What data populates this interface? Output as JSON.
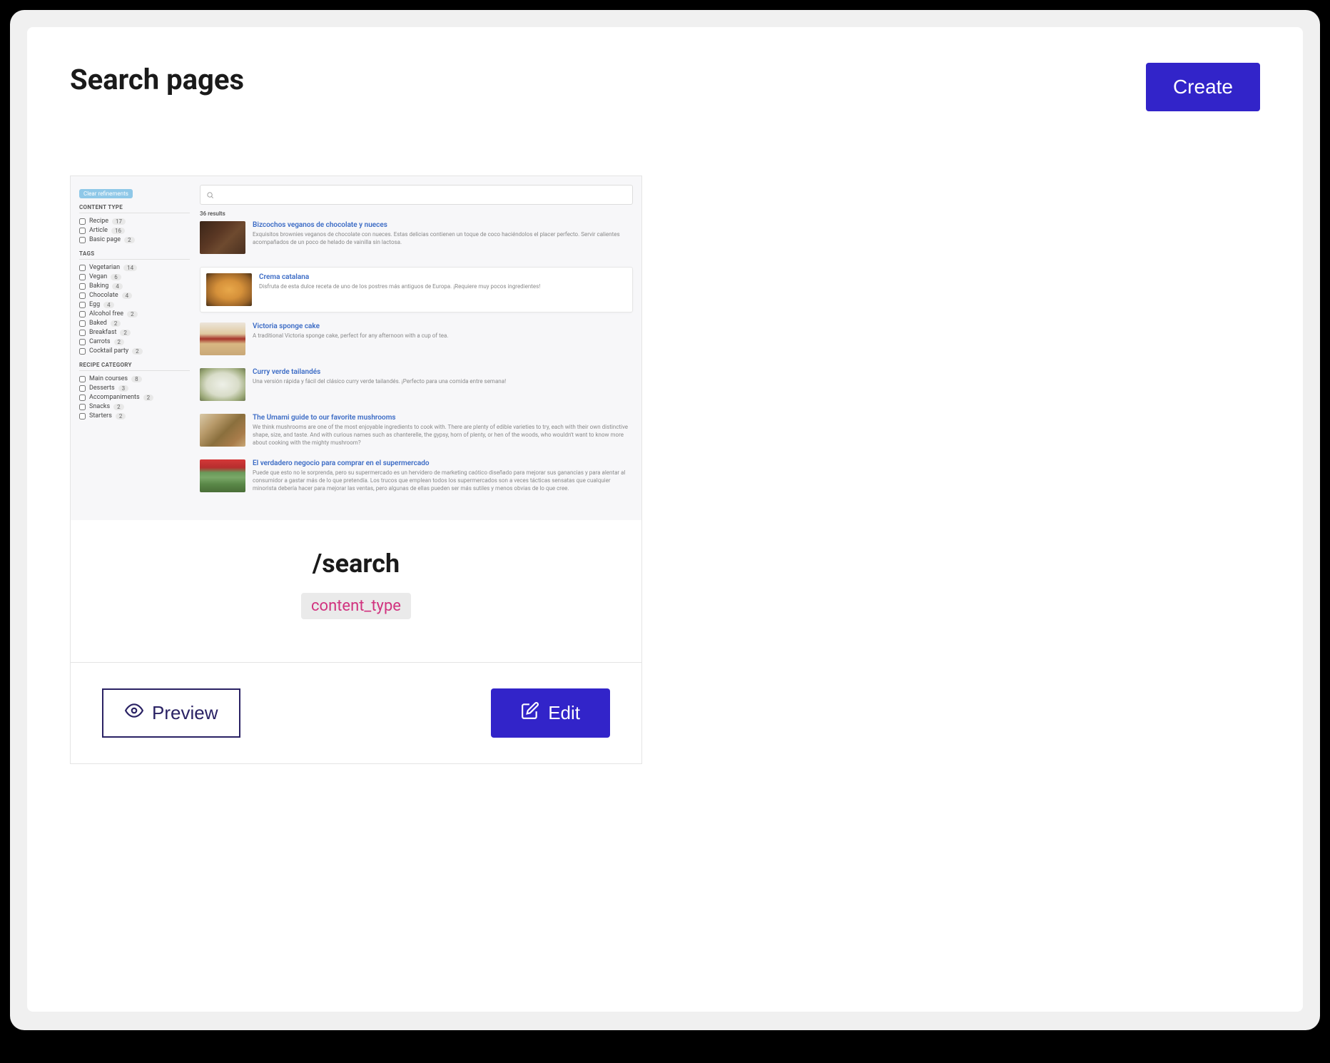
{
  "header": {
    "title": "Search pages",
    "create_label": "Create"
  },
  "preview": {
    "clear_label": "Clear refinements",
    "facets": [
      {
        "title": "CONTENT TYPE",
        "items": [
          {
            "label": "Recipe",
            "count": 17
          },
          {
            "label": "Article",
            "count": 16
          },
          {
            "label": "Basic page",
            "count": 2
          }
        ]
      },
      {
        "title": "TAGS",
        "items": [
          {
            "label": "Vegetarian",
            "count": 14
          },
          {
            "label": "Vegan",
            "count": 6
          },
          {
            "label": "Baking",
            "count": 4
          },
          {
            "label": "Chocolate",
            "count": 4
          },
          {
            "label": "Egg",
            "count": 4
          },
          {
            "label": "Alcohol free",
            "count": 2
          },
          {
            "label": "Baked",
            "count": 2
          },
          {
            "label": "Breakfast",
            "count": 2
          },
          {
            "label": "Carrots",
            "count": 2
          },
          {
            "label": "Cocktail party",
            "count": 2
          }
        ]
      },
      {
        "title": "RECIPE CATEGORY",
        "items": [
          {
            "label": "Main courses",
            "count": 8
          },
          {
            "label": "Desserts",
            "count": 3
          },
          {
            "label": "Accompaniments",
            "count": 2
          },
          {
            "label": "Snacks",
            "count": 2
          },
          {
            "label": "Starters",
            "count": 2
          }
        ]
      }
    ],
    "results_count": "36 results",
    "results": [
      {
        "title": "Bizcochos veganos de chocolate y nueces",
        "desc": "Exquisitos brownies veganos de chocolate con nueces. Estas delicias contienen un toque de coco haciéndolos el placer perfecto. Servir calientes acompañados de un poco de helado de vainilla sin lactosa.",
        "thumb_bg": "linear-gradient(135deg,#3a2518 0%,#5b3824 40%,#6e4a2f 60%,#4a3020 100%)",
        "highlighted": false
      },
      {
        "title": "Crema catalana",
        "desc": "Disfruta de esta dulce receta de uno de los postres más antiguos de Europa. ¡Requiere muy pocos ingredientes!",
        "thumb_bg": "radial-gradient(ellipse at center,#e8a84a 0%,#d6913a 40%,#9b6428 75%,#4a3218 100%)",
        "highlighted": true
      },
      {
        "title": "Victoria sponge cake",
        "desc": "A traditional Victoria sponge cake, perfect for any afternoon with a cup of tea.",
        "thumb_bg": "linear-gradient(180deg,#ece5da 0%,#e0c9a0 35%,#a6342a 50%,#d9b883 65%,#c9a877 100%)",
        "highlighted": false
      },
      {
        "title": "Curry verde tailandés",
        "desc": "Una versión rápida y fácil del clásico curry verde tailandés. ¡Perfecto para una comida entre semana!",
        "thumb_bg": "radial-gradient(ellipse at center,#eef0e8 0%,#d8dcc8 50%,#9ba878 80%,#6f7a52 100%)",
        "highlighted": false
      },
      {
        "title": "The Umami guide to our favorite mushrooms",
        "desc": "We think mushrooms are one of the most enjoyable ingredients to cook with. There are plenty of edible varieties to try, each with their own distinctive shape, size, and taste. And with curious names such as chanterelle, the gypsy, horn of plenty, or hen of the woods, who wouldn't want to know more about cooking with the mighty mushroom?",
        "thumb_bg": "linear-gradient(135deg,#d9c9a8 0%,#b89a6a 30%,#8a6f3d 55%,#a87c4a 80%,#c9a877 100%)",
        "highlighted": false
      },
      {
        "title": "El verdadero negocio para comprar en el supermercado",
        "desc": "Puede que esto no le sorprenda, pero su supermercado es un hervidero de marketing caótico diseñado para mejorar sus ganancias y para alentar al consumidor a gastar más de lo que pretendía. Los trucos que emplean todos los supermercados son a veces tácticas sensatas que cualquier minorista debería hacer para mejorar las ventas, pero algunas de ellas pueden ser más sutiles y menos obvias de lo que cree.",
        "thumb_bg": "linear-gradient(180deg,#d43838 0%,#b62e2e 25%,#6a9a5a 40%,#7aa868 55%,#5a8848 75%,#4a6e38 100%)",
        "highlighted": false
      }
    ]
  },
  "card_info": {
    "path": "/search",
    "tag": "content_type"
  },
  "actions": {
    "preview_label": "Preview",
    "edit_label": "Edit"
  }
}
